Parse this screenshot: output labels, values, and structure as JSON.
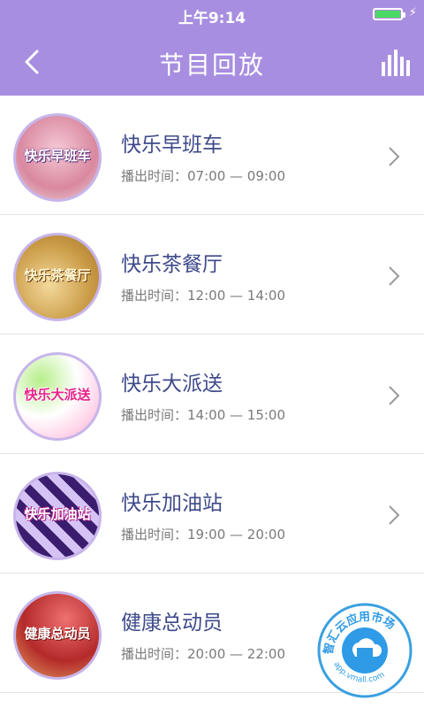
{
  "status": {
    "time": "上午9:14"
  },
  "header": {
    "title": "节目回放"
  },
  "programs": [
    {
      "thumb_label": "快乐早班车",
      "title": "快乐早班车",
      "time_label": "播出时间：",
      "time_range": "07:00 — 09:00"
    },
    {
      "thumb_label": "快乐茶餐厅",
      "title": "快乐茶餐厅",
      "time_label": "播出时间：",
      "time_range": "12:00 — 14:00"
    },
    {
      "thumb_label": "快乐大派送",
      "title": "快乐大派送",
      "time_label": "播出时间：",
      "time_range": "14:00 — 15:00"
    },
    {
      "thumb_label": "快乐加油站",
      "title": "快乐加油站",
      "time_label": "播出时间：",
      "time_range": "19:00 — 20:00"
    },
    {
      "thumb_label": "健康总动员",
      "title": "健康总动员",
      "time_label": "播出时间：",
      "time_range": "20:00 — 22:00"
    }
  ],
  "watermark": {
    "text": "智汇云应用市场",
    "url": "app.vmall.com"
  },
  "colors": {
    "header": "#a88ee0",
    "title_text": "#3e4a8a",
    "accent_border": "#c7b5ea"
  },
  "icons": {
    "back": "chevron-left-icon",
    "stats": "bar-chart-icon",
    "row": "chevron-right-icon"
  }
}
